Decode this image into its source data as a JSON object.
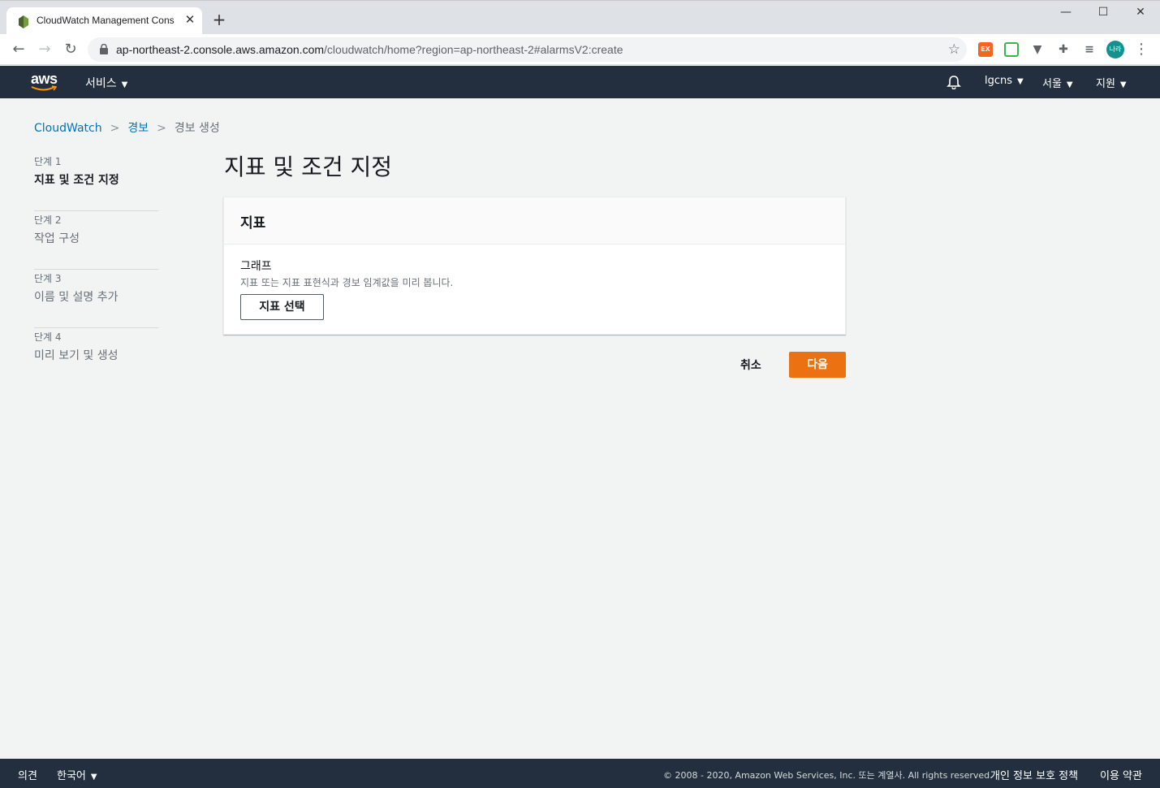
{
  "browser": {
    "tab_title": "CloudWatch Management Cons",
    "url_host": "ap-northeast-2.console.aws.amazon.com",
    "url_path": "/cloudwatch/home?region=ap-northeast-2#alarmsV2:create",
    "avatar_text": "나라",
    "extension_label": "EX"
  },
  "aws_header": {
    "logo": "aws",
    "services": "서비스",
    "account": "lgcns",
    "region": "서울",
    "support": "지원"
  },
  "breadcrumb": {
    "items": [
      "CloudWatch",
      "경보",
      "경보 생성"
    ]
  },
  "steps": [
    {
      "num": "단계 1",
      "label": "지표 및 조건 지정",
      "active": true
    },
    {
      "num": "단계 2",
      "label": "작업 구성",
      "active": false
    },
    {
      "num": "단계 3",
      "label": "이름 및 설명 추가",
      "active": false
    },
    {
      "num": "단계 4",
      "label": "미리 보기 및 생성",
      "active": false
    }
  ],
  "page_title": "지표 및 조건 지정",
  "panel": {
    "title": "지표",
    "graph_label": "그래프",
    "graph_desc": "지표 또는 지표 표현식과 경보 임계값을 미리 봅니다.",
    "select_button": "지표 선택"
  },
  "actions": {
    "cancel": "취소",
    "next": "다음"
  },
  "footer": {
    "feedback": "의견",
    "language": "한국어",
    "copyright": "© 2008 - 2020, Amazon Web Services, Inc. 또는 계열사. All rights reserved.",
    "privacy": "개인 정보 보호 정책",
    "terms": "이용 약관"
  },
  "colors": {
    "aws_nav": "#232f3e",
    "primary_button": "#ec7211",
    "link": "#0073bb"
  }
}
